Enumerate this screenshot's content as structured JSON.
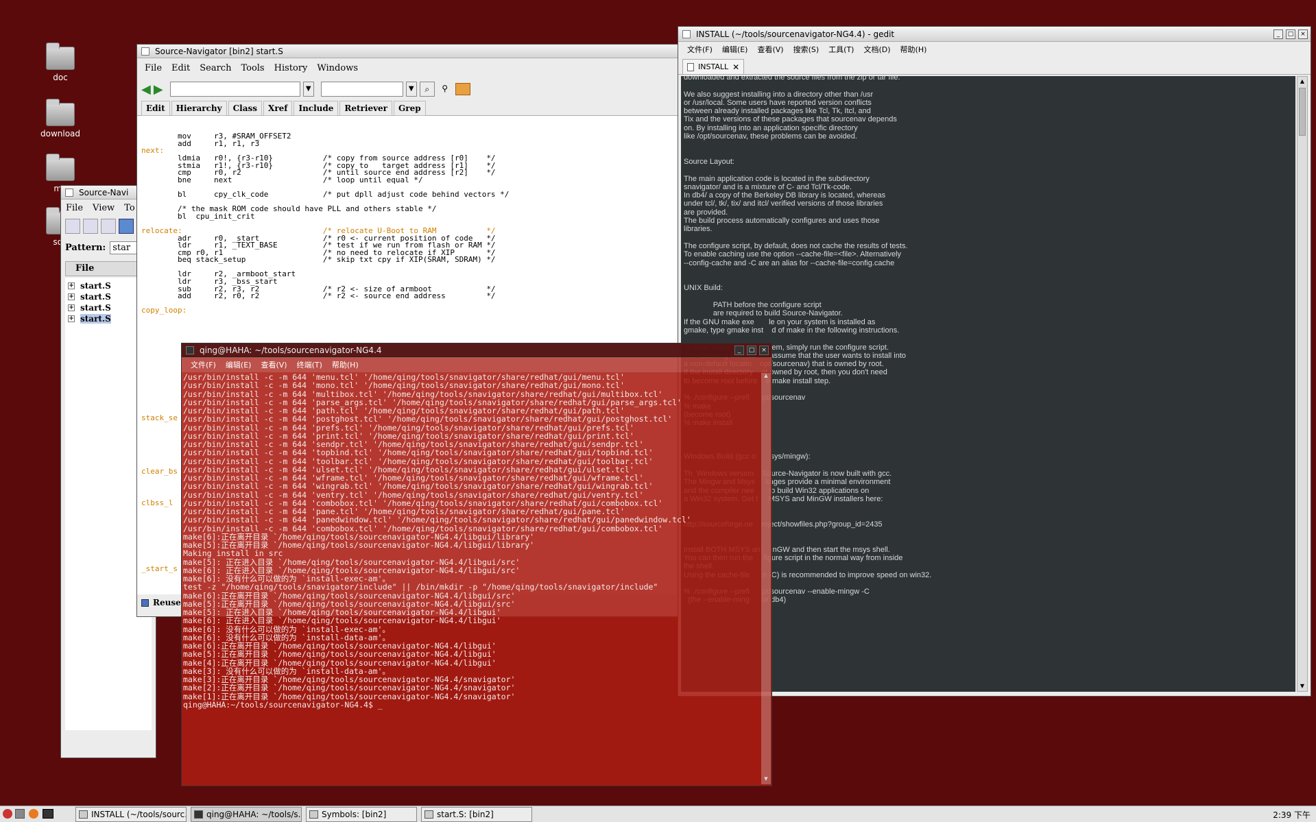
{
  "desktop": {
    "icons": [
      {
        "label": "doc"
      },
      {
        "label": "download"
      },
      {
        "label": "mu"
      },
      {
        "label": "sou"
      }
    ]
  },
  "symbols_window": {
    "title": "Source-Navi",
    "menu": [
      "File",
      "View",
      "To"
    ],
    "pattern_label": "Pattern:",
    "pattern_value": "star",
    "column_header": "File",
    "files": [
      "start.S",
      "start.S",
      "start.S",
      "start.S"
    ]
  },
  "sn_window": {
    "title": "Source-Navigator [bin2] start.S",
    "menu": [
      "File",
      "Edit",
      "Search",
      "Tools",
      "History",
      "Windows"
    ],
    "toolbar_tabs": [
      "Edit",
      "Hierarchy",
      "Class",
      "Xref",
      "Include",
      "Retriever",
      "Grep"
    ],
    "code_lines": [
      "        mov     r3, #SRAM_OFFSET2",
      "        add     r1, r1, r3",
      "next:",
      "        ldmia   r0!, {r3-r10}           /* copy from source address [r0]    */",
      "        stmia   r1!, {r3-r10}           /* copy to   target address [r1]    */",
      "        cmp     r0, r2                  /* until source end address [r2]    */",
      "        bne     next                    /* loop until equal */",
      "",
      "        bl      cpy_clk_code            /* put dpll adjust code behind vectors */",
      "",
      "        /* the mask ROM code should have PLL and others stable */",
      "        bl  cpu_init_crit",
      "",
      "relocate:                               /* relocate U-Boot to RAM           */",
      "        adr     r0, _start              /* r0 <- current position of code   */",
      "        ldr     r1, _TEXT_BASE          /* test if we run from flash or RAM */",
      "        cmp r0, r1                      /* no need to relocate if XIP       */",
      "        beq stack_setup                 /* skip txt cpy if XIP(SRAM, SDRAM) */",
      "",
      "        ldr     r2, _armboot_start",
      "        ldr     r3, _bss_start",
      "        sub     r2, r3, r2              /* r2 <- size of armboot            */",
      "        add     r2, r0, r2              /* r2 <- source end address         */",
      "",
      "copy_loop:"
    ],
    "side_labels": [
      "stack_se",
      "clear_bs",
      "clbss_l",
      "_start_s"
    ],
    "status": "Reuse"
  },
  "gedit": {
    "title": "INSTALL (~/tools/sourcenavigator-NG4.4) - gedit",
    "menu": [
      "文件(F)",
      "编辑(E)",
      "查看(V)",
      "搜索(S)",
      "工具(T)",
      "文档(D)",
      "帮助(H)"
    ],
    "tab_label": "INSTALL",
    "text_lines": [
      "downloaded and extracted the source files from the zip or tar file.",
      "",
      "We also suggest installing into a directory other than /usr",
      "or /usr/local. Some users have reported version conflicts",
      "between already installed packages like Tcl, Tk, Itcl, and",
      "Tix and the versions of these packages that sourcenav depends",
      "on. By installing into an application specific directory",
      "like /opt/sourcenav, these problems can be avoided.",
      "",
      "",
      "Source Layout:",
      "",
      "The main application code is located in the subdirectory",
      "snavigator/ and is a mixture of C- and Tcl/Tk-code.",
      "In db4/ a copy of the Berkeley DB library is located, whereas",
      "under tcl/, tk/, tix/ and itcl/ verified versions of those libraries",
      "are provided.",
      "The build process automatically configures and uses those",
      "libraries.",
      "",
      "The configure script, by default, does not cache the results of tests.",
      "To enable caching use the option --cache-file=<file>. Alternatively",
      "--config-cache and -C are an alias for --cache-file=config.cache",
      "",
      "",
      "UNIX Build:",
      "",
      "              PATH before the configure script",
      "              are required to build Source-Navigator.",
      "If the GNU make exe       le on your system is installed as",
      "gmake, type gmake inst    d of make in the following instructions.",
      "",
      "To build under a UNIX    stem, simply run the configure script.",
      "The following comma       assume that the user wants to install into",
      "a non-default locatio    opt/sourcenav) that is owned by root.",
      "If the install directory    ot owned by root, then you don't need",
      "to become root before    e make install step.",
      "",
      "% ./configure --prefi      pt/sourcenav",
      "% make",
      "(become root)",
      "% make install",
      "",
      "",
      "",
      "Windows Build (gcc o       sys/mingw):",
      "",
      "Th  Windows version    Source-Navigator is now built with gcc.",
      "The Mingw and Msys     kages provide a minimal environment",
      "and the compiler nee       to build Win32 applications on",
      "a Win32 system. Get t     MSYS and MinGW installers here:",
      "",
      "",
      "http://sourceforge.ne    roject/showfiles.php?group_id=2435",
      "",
      "",
      "Install BOTH MSYS an     inGW and then start the msys shell.",
      "You can then run the     figure script in the normal way from inside",
      "the shell.",
      "Using the cache-file      n -C) is recommended to improve speed on win32.",
      "",
      "% ./configure --prefi      pt/sourcenav --enable-mingw -C",
      "  (the --enable-ming      or db4)"
    ]
  },
  "terminal": {
    "title": "qing@HAHA: ~/tools/sourcenavigator-NG4.4",
    "menu": [
      "文件(F)",
      "编辑(E)",
      "查看(V)",
      "终端(T)",
      "帮助(H)"
    ],
    "lines": [
      "/usr/bin/install -c -m 644 'menu.tcl' '/home/qing/tools/snavigator/share/redhat/gui/menu.tcl'",
      "/usr/bin/install -c -m 644 'mono.tcl' '/home/qing/tools/snavigator/share/redhat/gui/mono.tcl'",
      "/usr/bin/install -c -m 644 'multibox.tcl' '/home/qing/tools/snavigator/share/redhat/gui/multibox.tcl'",
      "/usr/bin/install -c -m 644 'parse_args.tcl' '/home/qing/tools/snavigator/share/redhat/gui/parse_args.tcl'",
      "/usr/bin/install -c -m 644 'path.tcl' '/home/qing/tools/snavigator/share/redhat/gui/path.tcl'",
      "/usr/bin/install -c -m 644 'postghost.tcl' '/home/qing/tools/snavigator/share/redhat/gui/postghost.tcl'",
      "/usr/bin/install -c -m 644 'prefs.tcl' '/home/qing/tools/snavigator/share/redhat/gui/prefs.tcl'",
      "/usr/bin/install -c -m 644 'print.tcl' '/home/qing/tools/snavigator/share/redhat/gui/print.tcl'",
      "/usr/bin/install -c -m 644 'sendpr.tcl' '/home/qing/tools/snavigator/share/redhat/gui/sendpr.tcl'",
      "/usr/bin/install -c -m 644 'topbind.tcl' '/home/qing/tools/snavigator/share/redhat/gui/topbind.tcl'",
      "/usr/bin/install -c -m 644 'toolbar.tcl' '/home/qing/tools/snavigator/share/redhat/gui/toolbar.tcl'",
      "/usr/bin/install -c -m 644 'ulset.tcl' '/home/qing/tools/snavigator/share/redhat/gui/ulset.tcl'",
      "/usr/bin/install -c -m 644 'wframe.tcl' '/home/qing/tools/snavigator/share/redhat/gui/wframe.tcl'",
      "/usr/bin/install -c -m 644 'wingrab.tcl' '/home/qing/tools/snavigator/share/redhat/gui/wingrab.tcl'",
      "/usr/bin/install -c -m 644 'ventry.tcl' '/home/qing/tools/snavigator/share/redhat/gui/ventry.tcl'",
      "/usr/bin/install -c -m 644 'combobox.tcl' '/home/qing/tools/snavigator/share/redhat/gui/combobox.tcl'",
      "/usr/bin/install -c -m 644 'pane.tcl' '/home/qing/tools/snavigator/share/redhat/gui/pane.tcl'",
      "/usr/bin/install -c -m 644 'panedwindow.tcl' '/home/qing/tools/snavigator/share/redhat/gui/panedwindow.tcl'",
      "/usr/bin/install -c -m 644 'combobox.tcl' '/home/qing/tools/snavigator/share/redhat/gui/combobox.tcl'",
      "make[6]:正在离开目录 `/home/qing/tools/sourcenavigator-NG4.4/libgui/library'",
      "make[5]:正在离开目录 `/home/qing/tools/sourcenavigator-NG4.4/libgui/library'",
      "Making install in src",
      "make[5]: 正在进入目录 `/home/qing/tools/sourcenavigator-NG4.4/libgui/src'",
      "make[6]: 正在进入目录 `/home/qing/tools/sourcenavigator-NG4.4/libgui/src'",
      "make[6]: 没有什么可以做的为 `install-exec-am'。",
      "test -z \"/home/qing/tools/snavigator/include\" || /bin/mkdir -p \"/home/qing/tools/snavigator/include\"",
      "make[6]:正在离开目录 `/home/qing/tools/sourcenavigator-NG4.4/libgui/src'",
      "make[5]:正在离开目录 `/home/qing/tools/sourcenavigator-NG4.4/libgui/src'",
      "make[5]: 正在进入目录 `/home/qing/tools/sourcenavigator-NG4.4/libgui'",
      "make[6]: 正在进入目录 `/home/qing/tools/sourcenavigator-NG4.4/libgui'",
      "make[6]: 没有什么可以做的为 `install-exec-am'。",
      "make[6]: 没有什么可以做的为 `install-data-am'。",
      "make[6]:正在离开目录 `/home/qing/tools/sourcenavigator-NG4.4/libgui'",
      "make[5]:正在离开目录 `/home/qing/tools/sourcenavigator-NG4.4/libgui'",
      "make[4]:正在离开目录 `/home/qing/tools/sourcenavigator-NG4.4/libgui'",
      "make[3]: 没有什么可以做的为 `install-data-am'。",
      "make[3]:正在离开目录 `/home/qing/tools/sourcenavigator-NG4.4/snavigator'",
      "make[2]:正在离开目录 `/home/qing/tools/sourcenavigator-NG4.4/snavigator'",
      "make[1]:正在离开目录 `/home/qing/tools/sourcenavigator-NG4.4/snavigator'",
      "qing@HAHA:~/tools/sourcenavigator-NG4.4$ _"
    ]
  },
  "taskbar": {
    "tasks": [
      {
        "label": "INSTALL (~/tools/sourc..."
      },
      {
        "label": "qing@HAHA: ~/tools/s..."
      },
      {
        "label": "Symbols: [bin2]"
      },
      {
        "label": "start.S: [bin2]"
      }
    ],
    "clock": "2:39 下午"
  }
}
